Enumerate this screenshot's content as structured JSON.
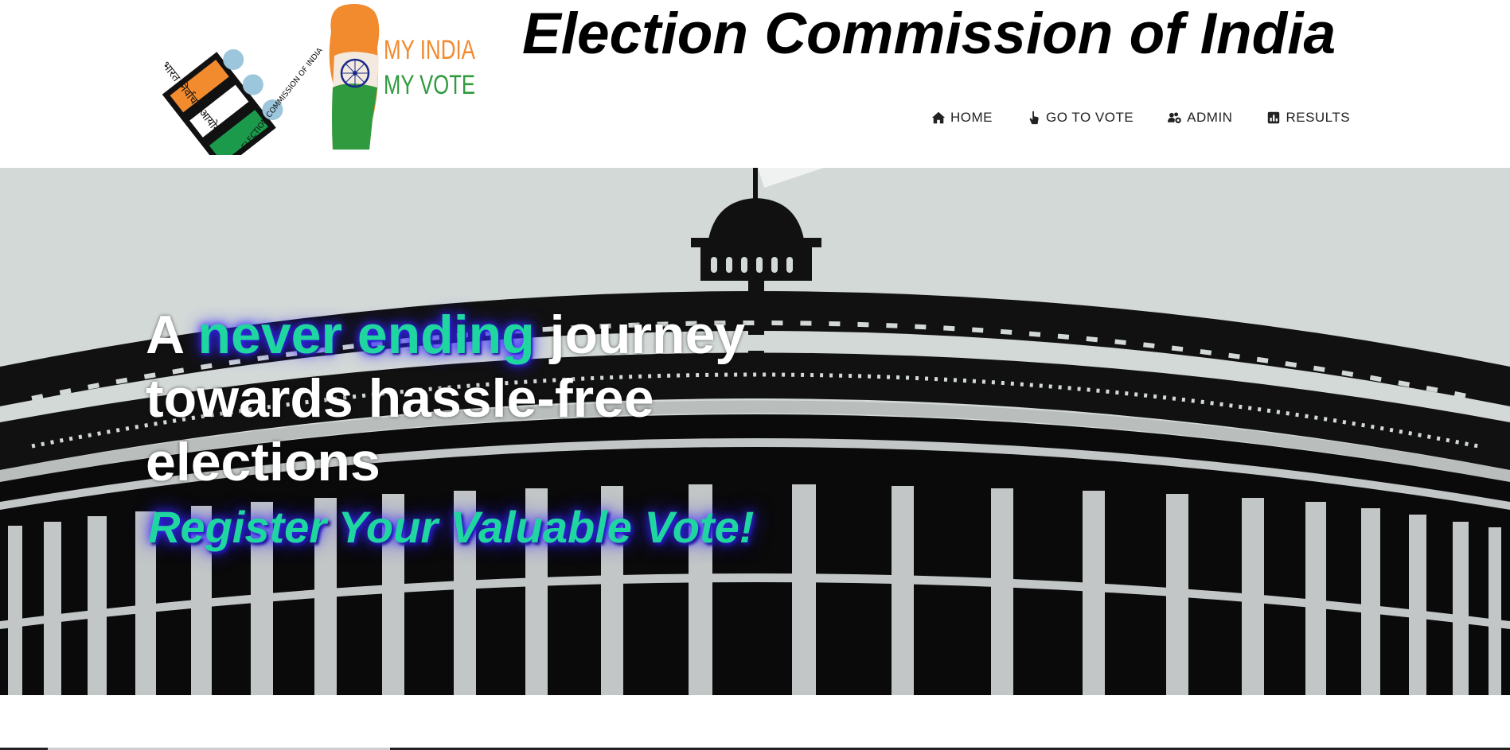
{
  "header": {
    "logo_eci_text_hindi": "भारत निर्वाचन आयोग",
    "logo_eci_text_english": "ELECTION COMMISSION OF INDIA",
    "logo_vote_line1": "MY INDIA",
    "logo_vote_line2": "MY VOTE",
    "title": "Election Commission of India"
  },
  "nav": {
    "items": [
      {
        "label": "HOME",
        "icon": "home-icon"
      },
      {
        "label": "GO TO VOTE",
        "icon": "hand-pointer-icon"
      },
      {
        "label": "ADMIN",
        "icon": "users-cog-icon"
      },
      {
        "label": "RESULTS",
        "icon": "bar-chart-icon"
      }
    ]
  },
  "hero": {
    "headline_part1": "A ",
    "headline_highlight": "never ending",
    "headline_part2": " journey towards hassle-free elections",
    "tagline": "Register Your Valuable Vote!"
  },
  "colors": {
    "highlight": "#1fd6a0",
    "glow": "#2b1cff",
    "saffron": "#f28a2e",
    "green": "#1a9a4a",
    "logo_blue": "#9cc6dc"
  }
}
